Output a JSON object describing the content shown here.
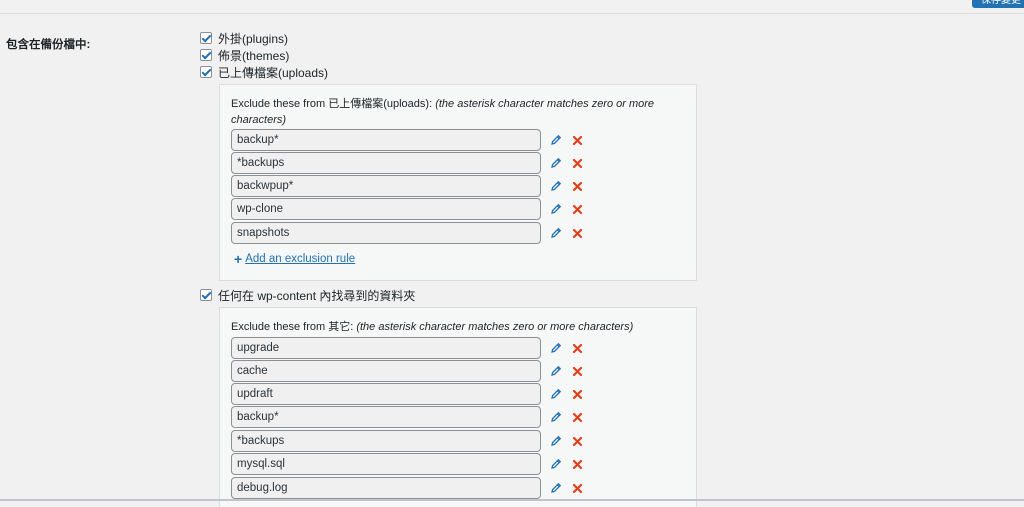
{
  "header": {
    "button_label": "保存變更"
  },
  "section": {
    "label": "包含在備份檔中:"
  },
  "checkboxes": [
    {
      "label": "外掛(plugins)",
      "checked": true
    },
    {
      "label": "佈景(themes)",
      "checked": true
    },
    {
      "label": "已上傳檔案(uploads)",
      "checked": true
    },
    {
      "label": "任何在 wp-content 內找尋到的資料夾",
      "checked": true
    }
  ],
  "uploads_panel": {
    "desc_prefix": "Exclude these from 已上傳檔案(uploads): ",
    "desc_note": "(the asterisk character matches zero or more characters)",
    "rules": [
      "backup*",
      "*backups",
      "backwpup*",
      "wp-clone",
      "snapshots"
    ],
    "add_label": "Add an exclusion rule"
  },
  "others_panel": {
    "desc_prefix": "Exclude these from 其它: ",
    "desc_note": "(the asterisk character matches zero or more characters)",
    "rules": [
      "upgrade",
      "cache",
      "updraft",
      "backup*",
      "*backups",
      "mysql.sql",
      "debug.log"
    ]
  },
  "icons": {
    "edit": "pencil-icon",
    "delete": "x-delete-icon"
  },
  "colors": {
    "accent": "#2271b1",
    "delete": "#e2401c"
  }
}
